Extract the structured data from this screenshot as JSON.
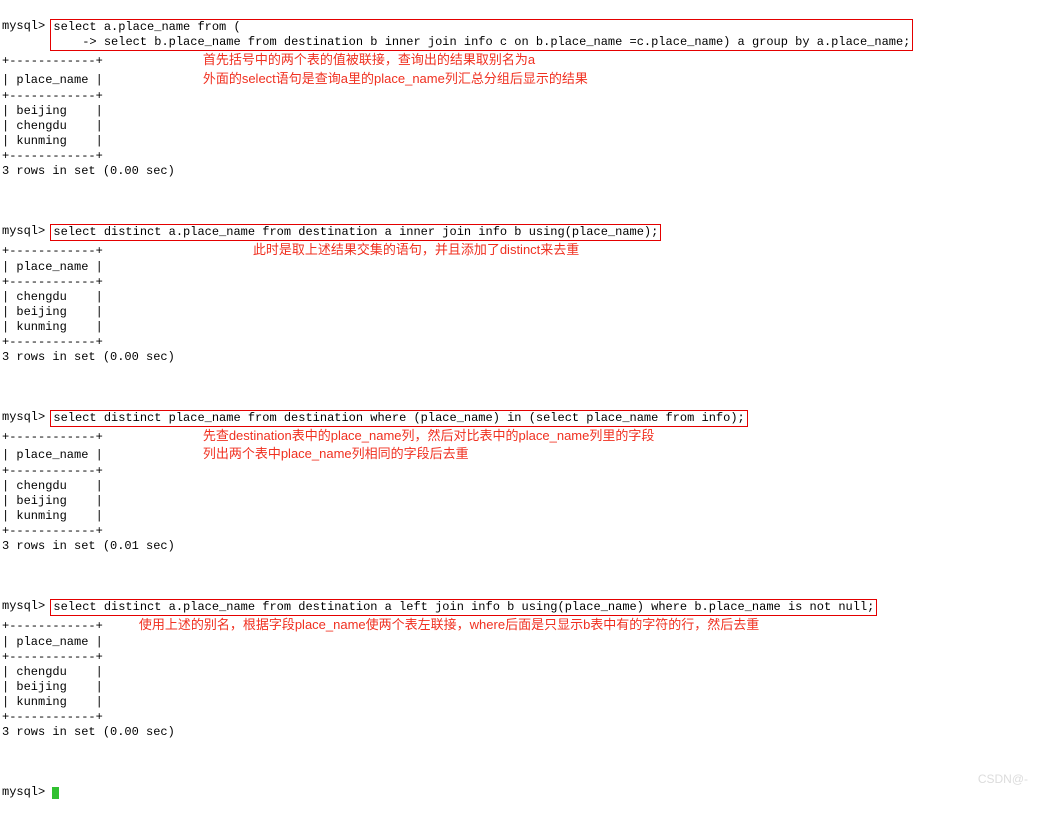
{
  "block1": {
    "prompt1": "mysql> ",
    "sql_line1": "select a.place_name from (",
    "prompt2": "    -> ",
    "sql_line2": "select b.place_name from destination b inner join info c on b.place_name =c.place_name) a group by a.place_name;",
    "sep": "+------------+",
    "header": "| place_name |",
    "row1": "| beijing    |",
    "row2": "| chengdu    |",
    "row3": "| kunming    |",
    "footer": "3 rows in set (0.00 sec)",
    "note_line1": "首先括号中的两个表的值被联接，查询出的结果取别名为a",
    "note_line2": "外面的select语句是查询a里的place_name列汇总分组后显示的结果"
  },
  "block2": {
    "prompt": "mysql> ",
    "sql": "select distinct a.place_name from destination a inner join info b using(place_name);",
    "sep": "+------------+",
    "header": "| place_name |",
    "row1": "| chengdu    |",
    "row2": "| beijing    |",
    "row3": "| kunming    |",
    "footer": "3 rows in set (0.00 sec)",
    "note_line1": "此时是取上述结果交集的语句，并且添加了distinct来去重"
  },
  "block3": {
    "prompt": "mysql> ",
    "sql": "select distinct place_name from destination where (place_name) in (select place_name from info);",
    "sep": "+------------+",
    "header": "| place_name |",
    "row1": "| chengdu    |",
    "row2": "| beijing    |",
    "row3": "| kunming    |",
    "footer": "3 rows in set (0.01 sec)",
    "note_line1": "先查destination表中的place_name列，然后对比表中的place_name列里的字段",
    "note_line2": "列出两个表中place_name列相同的字段后去重"
  },
  "block4": {
    "prompt": "mysql> ",
    "sql": "select distinct a.place_name from destination a left join info b using(place_name) where b.place_name is not null;",
    "sep": "+------------+",
    "header": "| place_name |",
    "row1": "| chengdu    |",
    "row2": "| beijing    |",
    "row3": "| kunming    |",
    "footer": "3 rows in set (0.00 sec)",
    "note_line1": "使用上述的别名，根据字段place_name使两个表左联接，where后面是只显示b表中有的字符的行，然后去重"
  },
  "tail": {
    "prompt": "mysql> "
  },
  "watermark": "CSDN@-"
}
